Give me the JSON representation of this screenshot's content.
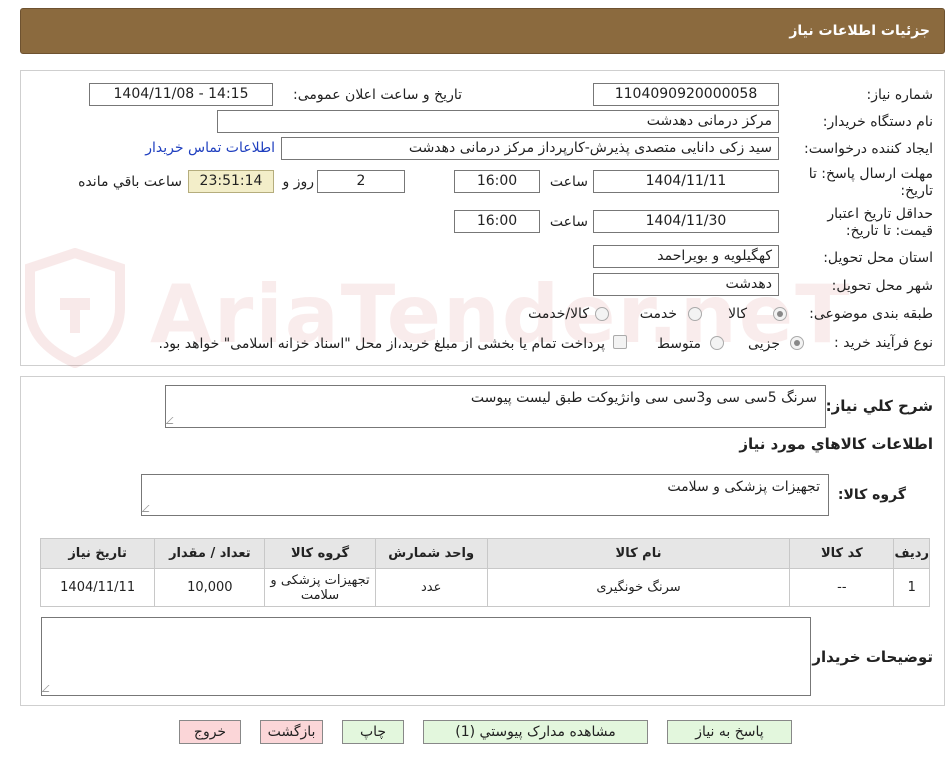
{
  "header": {
    "title": "جزئیات اطلاعات نیاز"
  },
  "watermark": {
    "text": "AriaTender.neT"
  },
  "form": {
    "need_number": {
      "label": "شماره نیاز:",
      "value": "1104090920000058"
    },
    "announce": {
      "label": "تاریخ و ساعت اعلان عمومی:",
      "value": "1404/11/08 - 14:15"
    },
    "buyer_org": {
      "label": "نام دستگاه خریدار:",
      "value": "مرکز درمانی دهدشت"
    },
    "requester": {
      "label": "ایجاد کننده درخواست:",
      "value": "سید زکی دانایی متصدی پذیرش-کارپرداز مرکز درمانی دهدشت",
      "contact_link": "اطلاعات تماس خریدار"
    },
    "reply_deadline": {
      "label": "مهلت ارسال پاسخ: تا تاریخ:",
      "date": "1404/11/11",
      "time_label": "ساعت",
      "time": "16:00",
      "days": "2",
      "days_label": "روز و",
      "remaining": "23:51:14",
      "remaining_label": "ساعت باقي مانده"
    },
    "price_validity": {
      "label": "حداقل تاریخ اعتبار قیمت: تا تاریخ:",
      "date": "1404/11/30",
      "time_label": "ساعت",
      "time": "16:00"
    },
    "province": {
      "label": "استان محل تحویل:",
      "value": "کهگیلویه و بویراحمد"
    },
    "city": {
      "label": "شهر محل تحویل:",
      "value": "دهدشت"
    },
    "category": {
      "label": "طبقه بندی موضوعی:",
      "options": [
        "کالا",
        "خدمت",
        "کالا/خدمت"
      ],
      "selected": "کالا"
    },
    "purchase_type": {
      "label": "نوع فرآیند خرید :",
      "options": [
        "جزیی",
        "متوسط"
      ],
      "selected": "جزیی",
      "note": "پرداخت تمام یا بخشی از مبلغ خرید،از محل \"اسناد خزانه اسلامی\" خواهد بود."
    }
  },
  "summary": {
    "label": "شرح کلي نياز:",
    "value": "سرنگ 5سی سی و3سی سی وانژیوکت طبق لیست پیوست"
  },
  "goods_section": {
    "title": "اطلاعات کالاهاي مورد نياز"
  },
  "goods_group": {
    "label": "گروه کالا:",
    "value": "تجهیزات پزشکی و سلامت"
  },
  "table": {
    "headers": [
      "ردیف",
      "کد کالا",
      "نام کالا",
      "واحد شمارش",
      "گروه کالا",
      "تعداد / مقدار",
      "تاریخ نیاز"
    ],
    "rows": [
      [
        "1",
        "--",
        "سرنگ خونگیری",
        "عدد",
        "تجهیزات پزشکی و سلامت",
        "10,000",
        "1404/11/11"
      ]
    ]
  },
  "buyer_notes": {
    "label": "توضیحات خریدار:",
    "value": ""
  },
  "buttons": {
    "reply": "پاسخ به نیاز",
    "attachments": "مشاهده مدارک پیوستي (1)",
    "print": "چاپ",
    "back": "بازگشت",
    "exit": "خروج"
  },
  "colors": {
    "header_bg": "#8b6a3e",
    "link": "#1f3fbf",
    "button_green": "#e3f7dd",
    "button_pink": "#fbd6d8",
    "timer_bg": "#f3eec9"
  }
}
